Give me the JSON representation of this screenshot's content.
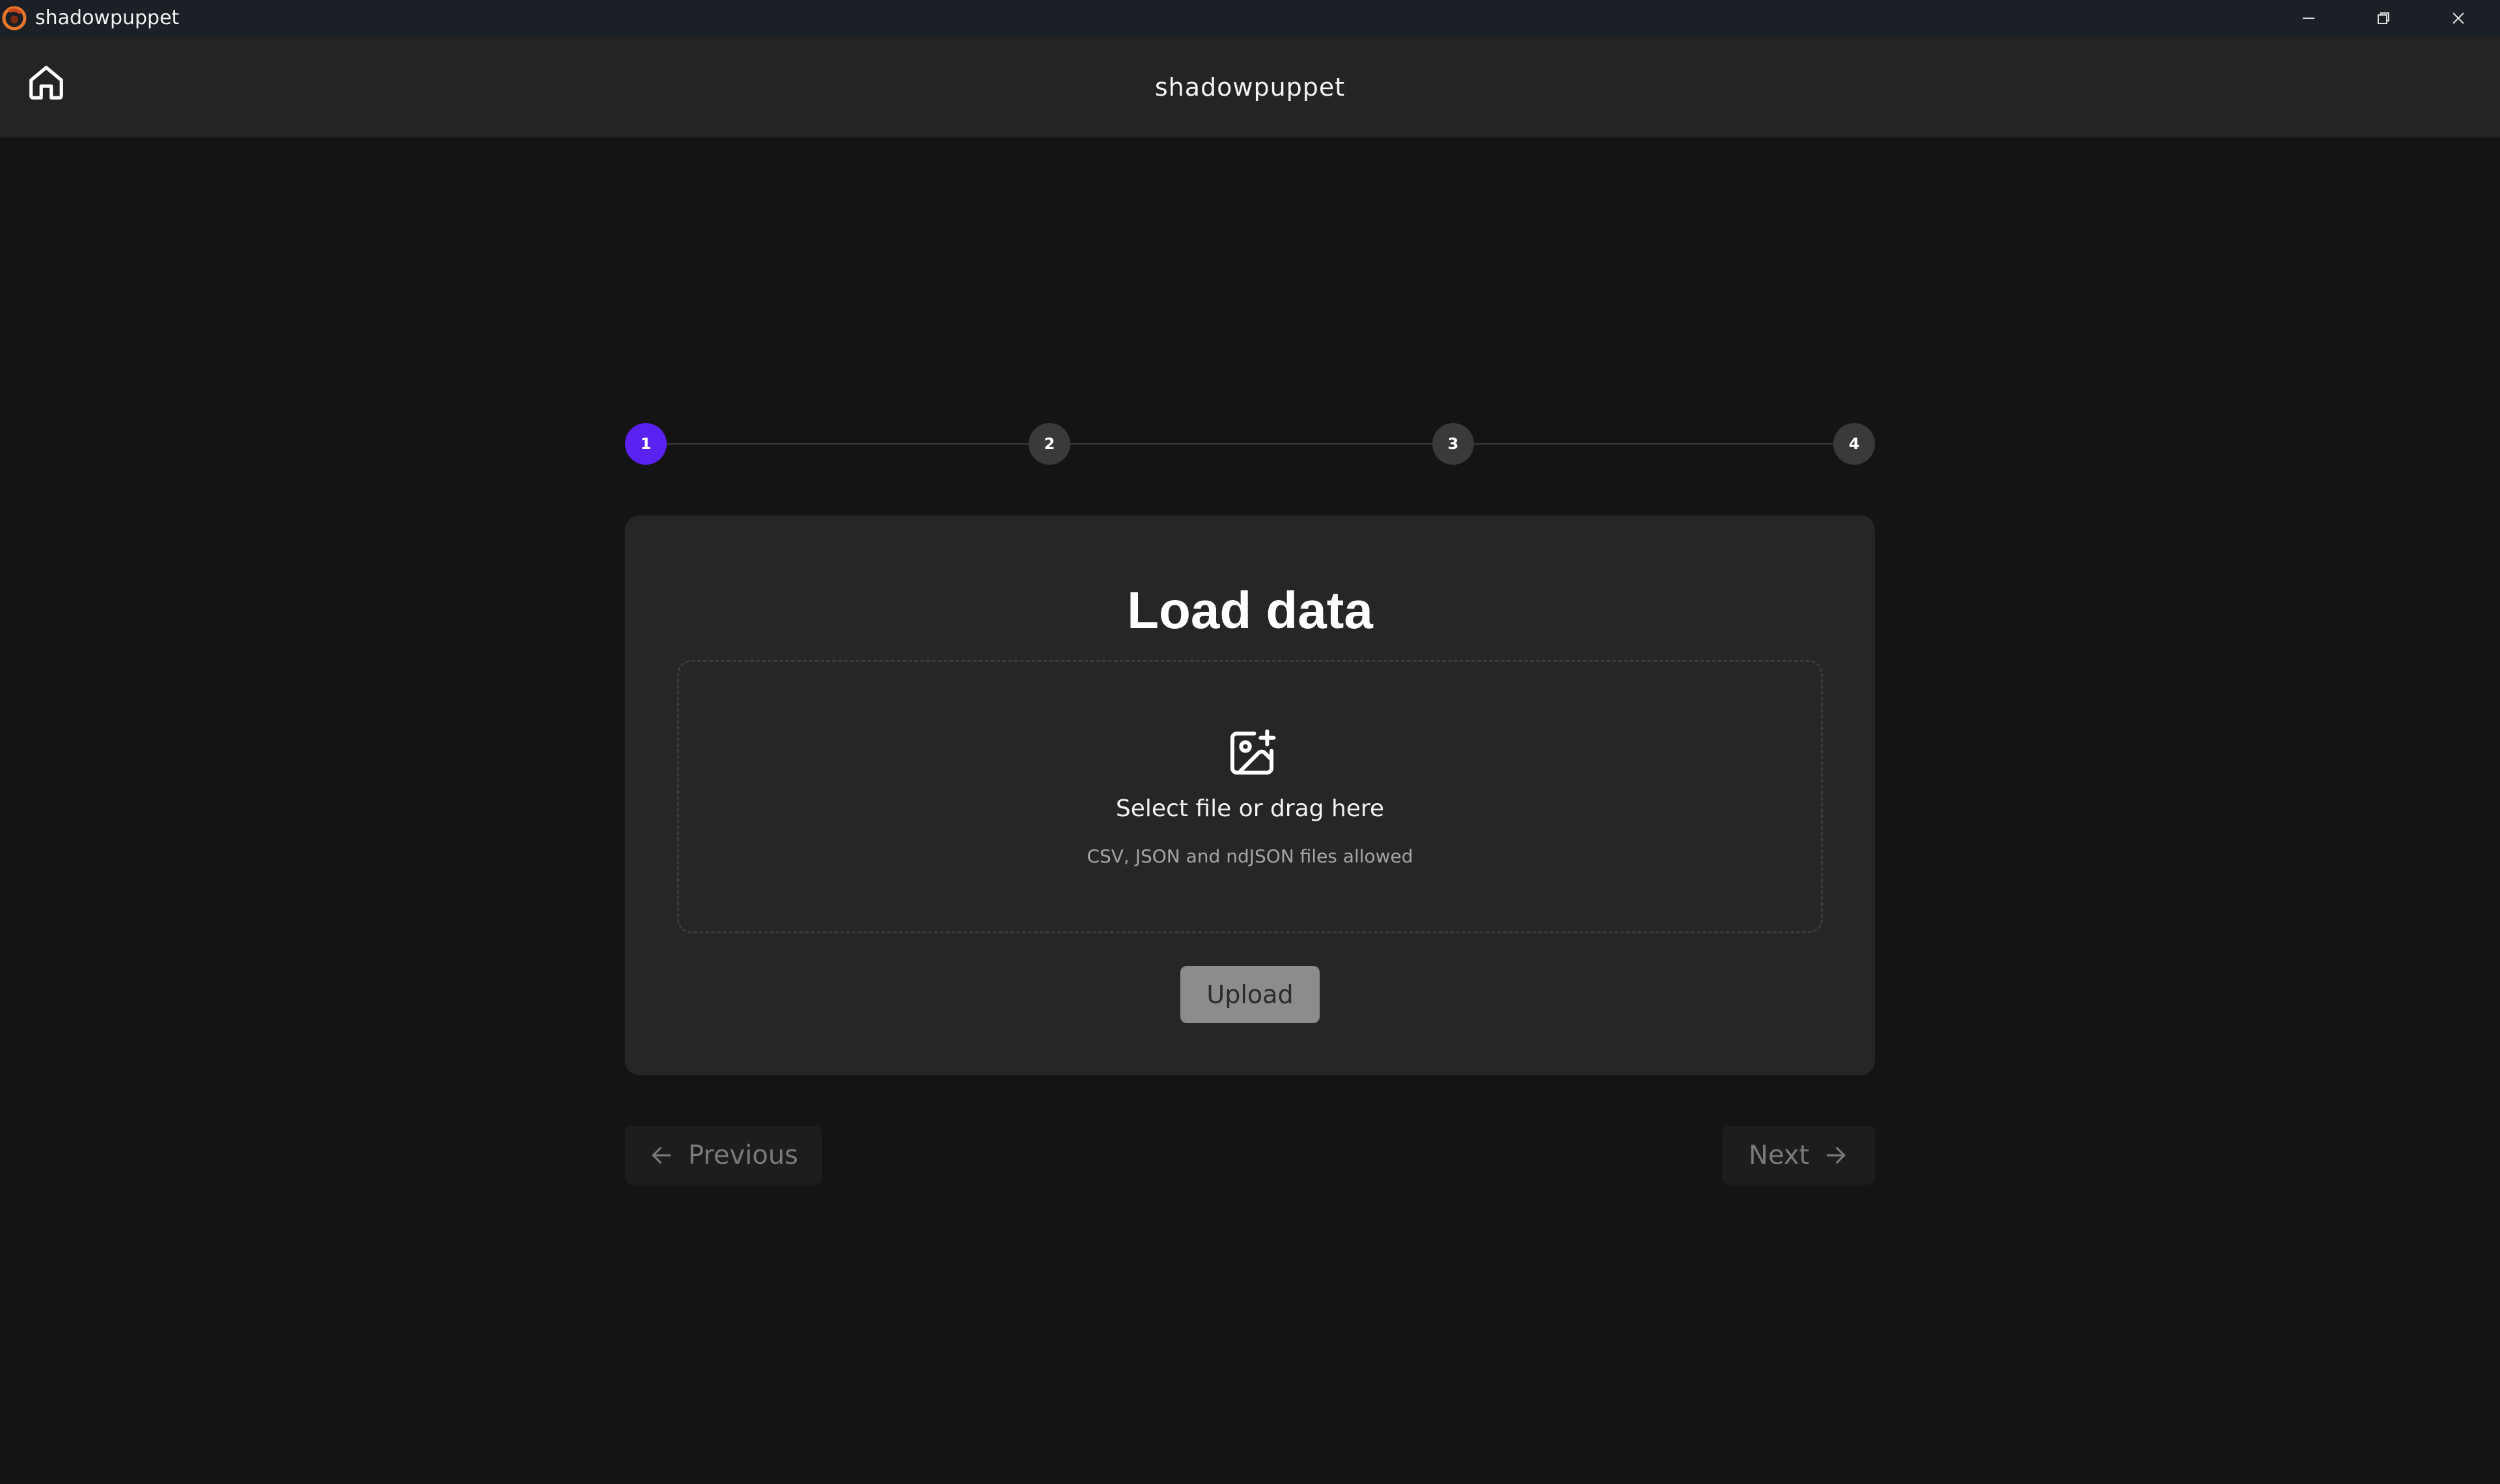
{
  "window": {
    "title": "shadowpuppet",
    "controls": {
      "minimize_icon": "minimize-icon",
      "maximize_icon": "restore-icon",
      "close_icon": "close-icon"
    }
  },
  "header": {
    "title": "shadowpuppet",
    "home_icon": "home-icon"
  },
  "stepper": {
    "steps": [
      {
        "label": "1",
        "active": true
      },
      {
        "label": "2",
        "active": false
      },
      {
        "label": "3",
        "active": false
      },
      {
        "label": "4",
        "active": false
      }
    ],
    "active_color": "#5b21f0",
    "inactive_color": "#3a3a3a"
  },
  "card": {
    "title": "Load data",
    "dropzone": {
      "icon": "image-plus-icon",
      "primary_text": "Select file or drag here",
      "secondary_text": "CSV, JSON and ndJSON files allowed"
    },
    "upload_label": "Upload"
  },
  "navigation": {
    "previous_label": "Previous",
    "previous_icon": "arrow-left-icon",
    "next_label": "Next",
    "next_icon": "arrow-right-icon"
  },
  "colors": {
    "background": "#141414",
    "header": "#242424",
    "card": "#262626",
    "accent": "#5b21f0"
  }
}
